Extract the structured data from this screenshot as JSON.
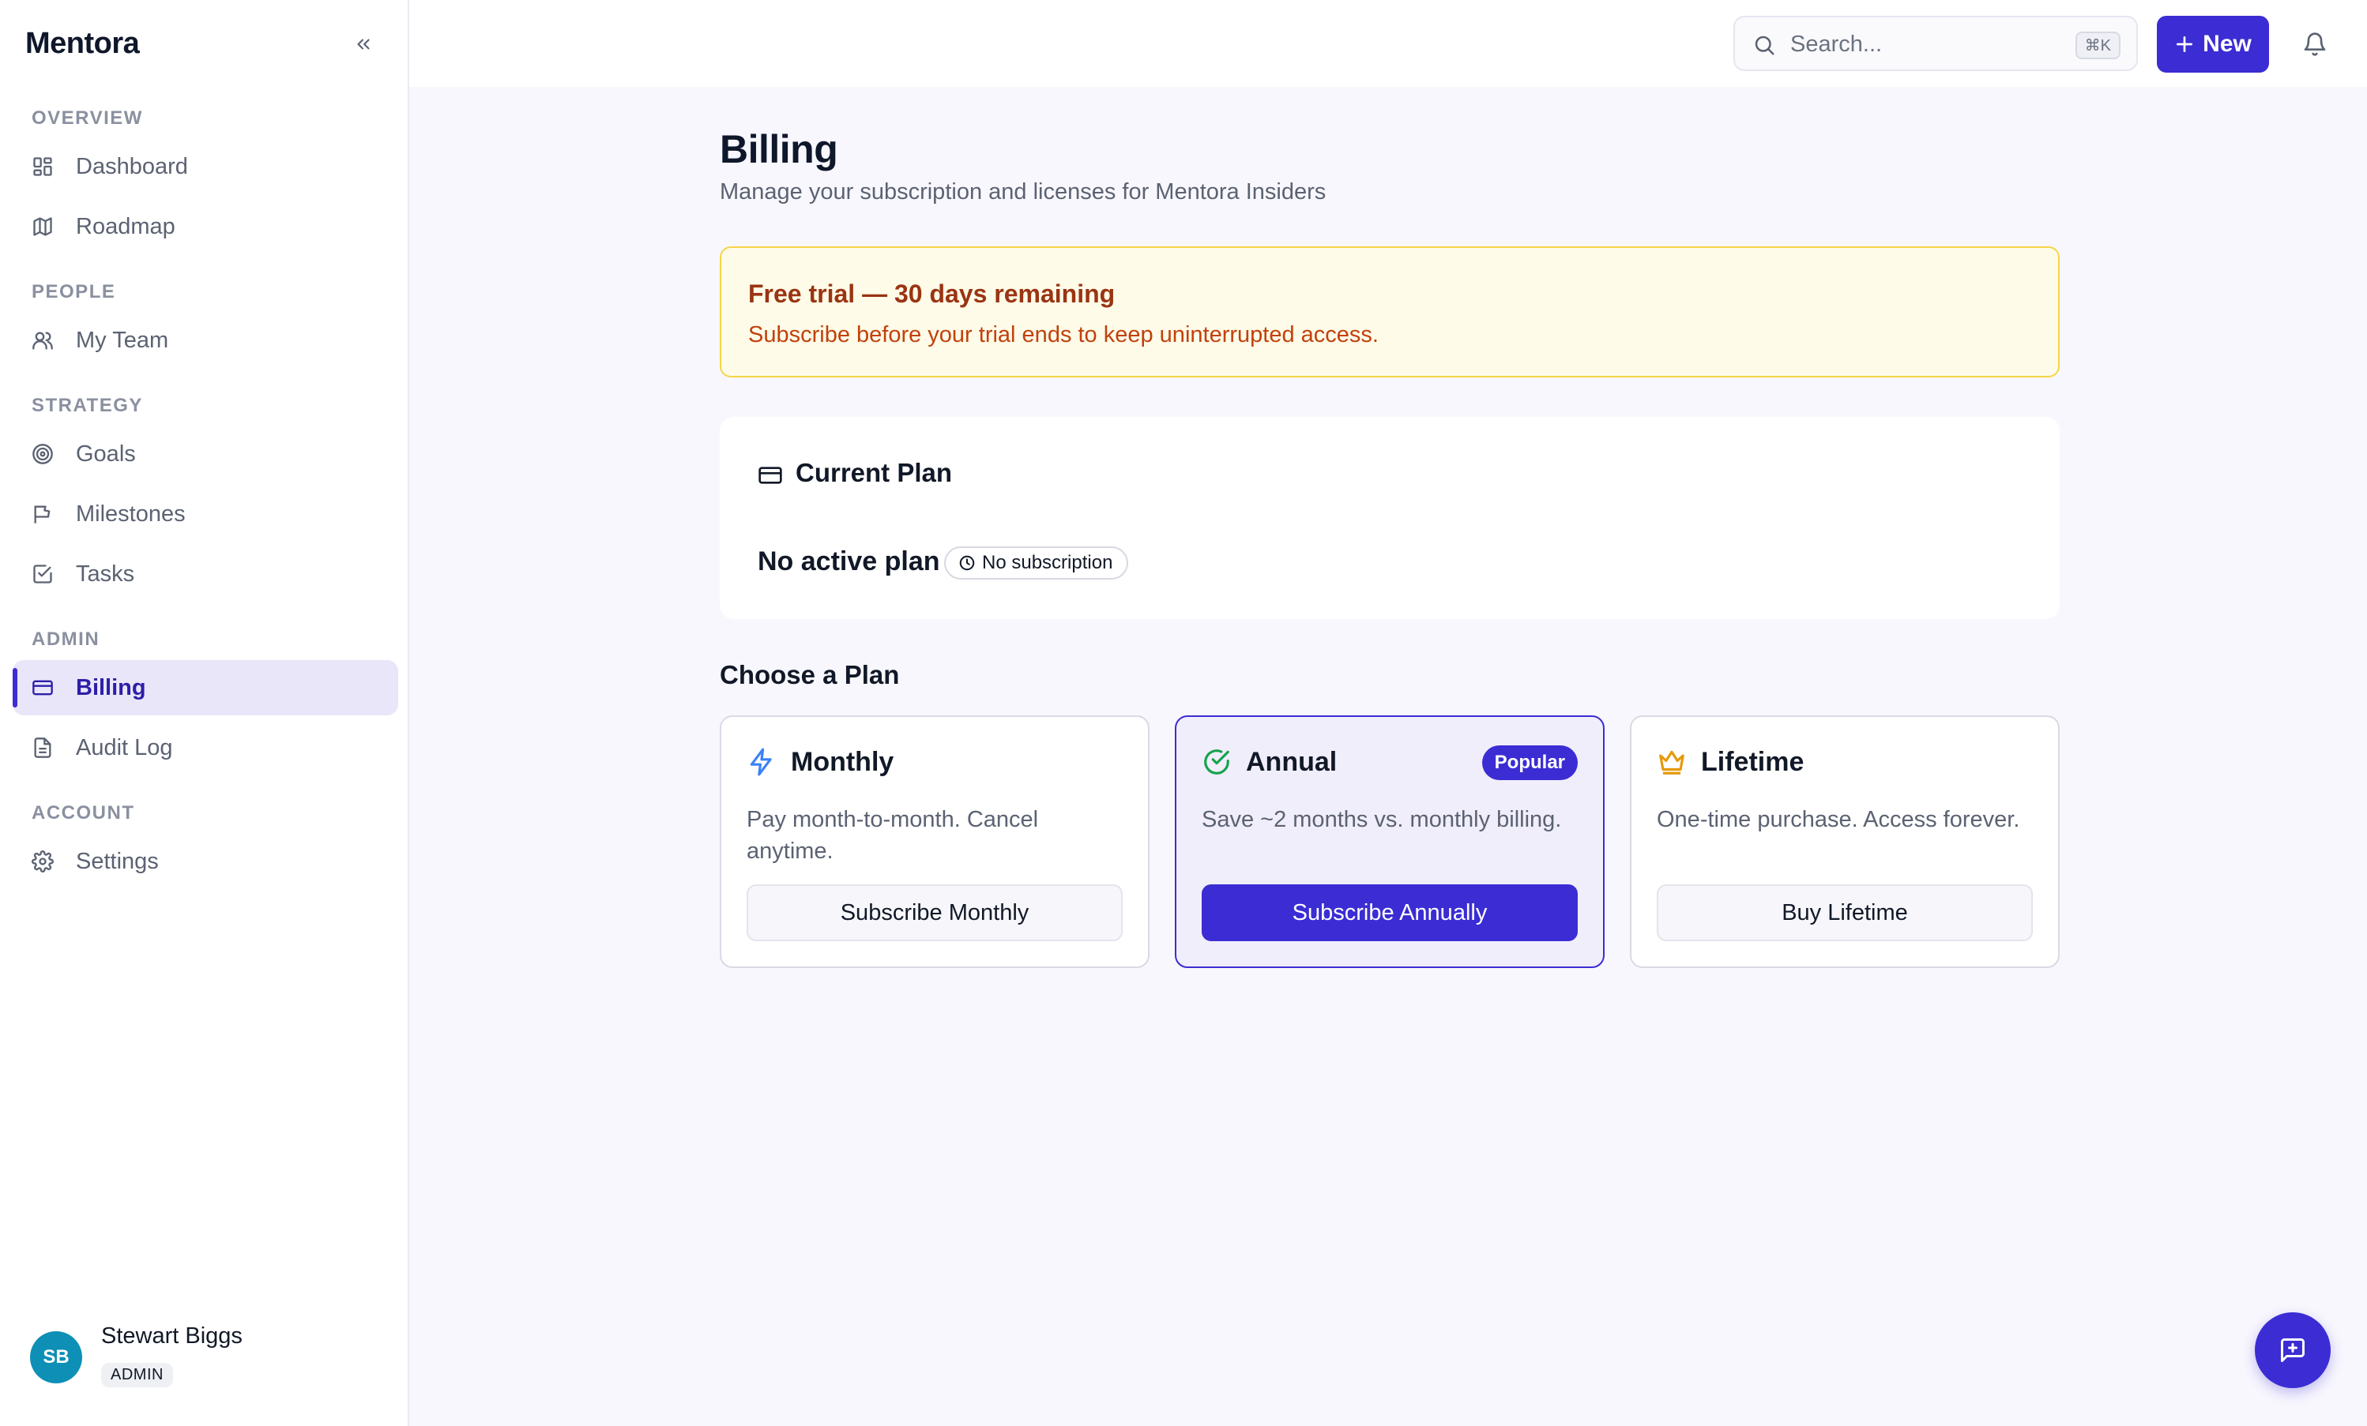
{
  "app": {
    "brand": "Mentora"
  },
  "sidebar": {
    "sections": {
      "overview": "OVERVIEW",
      "people": "PEOPLE",
      "strategy": "STRATEGY",
      "admin": "ADMIN",
      "account": "ACCOUNT"
    },
    "items": {
      "dashboard": "Dashboard",
      "roadmap": "Roadmap",
      "my_team": "My Team",
      "goals": "Goals",
      "milestones": "Milestones",
      "tasks": "Tasks",
      "billing": "Billing",
      "audit_log": "Audit Log",
      "settings": "Settings"
    },
    "active_item": "Billing"
  },
  "user": {
    "initials": "SB",
    "name": "Stewart Biggs",
    "role": "ADMIN"
  },
  "topbar": {
    "search_placeholder": "Search...",
    "search_shortcut": "⌘K",
    "new_label": "New"
  },
  "page": {
    "title": "Billing",
    "subtitle": "Manage your subscription and licenses for Mentora Insiders"
  },
  "trial": {
    "title": "Free trial — 30 days remaining",
    "text": "Subscribe before your trial ends to keep uninterrupted access."
  },
  "current_plan": {
    "title": "Current Plan",
    "status": "No active plan",
    "badge": "No subscription"
  },
  "plans": {
    "heading": "Choose a Plan",
    "monthly": {
      "name": "Monthly",
      "description": "Pay month-to-month. Cancel anytime.",
      "button": "Subscribe Monthly",
      "icon": "lightning-icon"
    },
    "annual": {
      "name": "Annual",
      "badge": "Popular",
      "description": "Save ~2 months vs. monthly billing.",
      "button": "Subscribe Annually",
      "icon": "check-circle-icon"
    },
    "lifetime": {
      "name": "Lifetime",
      "description": "One-time purchase. Access forever.",
      "button": "Buy Lifetime",
      "icon": "crown-icon"
    }
  },
  "colors": {
    "accent": "#3b2dd3",
    "trial_bg": "#fefbe8",
    "trial_border": "#f5d547",
    "trial_title": "#9a3412",
    "avatar": "#0e8fb5"
  }
}
